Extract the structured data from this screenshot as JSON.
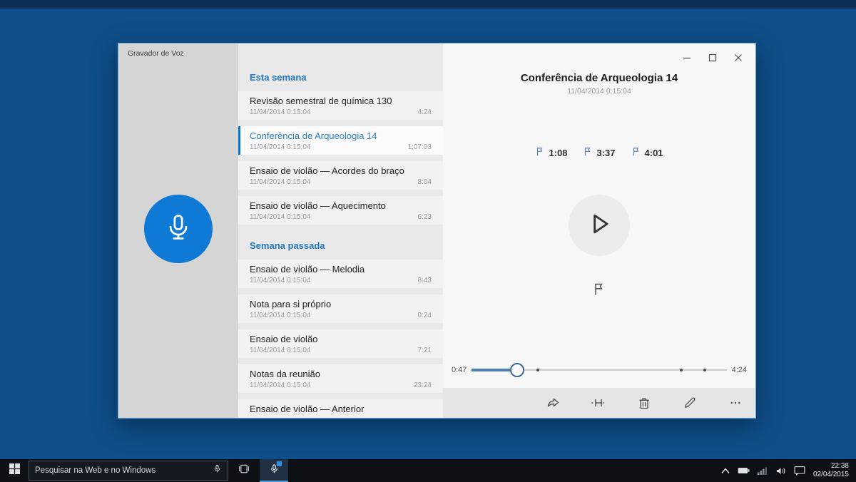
{
  "window": {
    "title": "Gravador de Voz"
  },
  "list": {
    "sections": [
      {
        "header": "Esta semana",
        "items": [
          {
            "title": "Revisão semestral de química 130",
            "date": "11/04/2014 0:15:04",
            "duration": "4:24"
          },
          {
            "title": "Conferência de Arqueologia 14",
            "date": "11/04/2014 0:15:04",
            "duration": "1:07:03",
            "selected": true
          },
          {
            "title": "Ensaio de violão — Acordes do braço",
            "date": "11/04/2014 0:15:04",
            "duration": "8:04"
          },
          {
            "title": "Ensaio de violão — Aquecimento",
            "date": "11/04/2014 0:15:04",
            "duration": "6:23"
          }
        ]
      },
      {
        "header": "Semana passada",
        "items": [
          {
            "title": "Ensaio de violão — Melodia",
            "date": "11/04/2014 0:15:04",
            "duration": "8:43"
          },
          {
            "title": "Nota para si próprio",
            "date": "11/04/2014 0:15:04",
            "duration": "0:24"
          },
          {
            "title": "Ensaio de violão",
            "date": "11/04/2014 0:15:04",
            "duration": "7:21"
          },
          {
            "title": "Notas da reunião",
            "date": "11/04/2014 0:15:04",
            "duration": "23:24"
          },
          {
            "title": "Ensaio de violão — Anterior"
          }
        ]
      }
    ]
  },
  "player": {
    "title": "Conferência de Arqueologia 14",
    "date": "11/04/2014 0:15:04",
    "markers": [
      {
        "time": "1:08"
      },
      {
        "time": "3:37"
      },
      {
        "time": "4:01"
      }
    ],
    "current_time": "0:47",
    "total_time": "4:24"
  },
  "taskbar": {
    "search_placeholder": "Pesquisar na Web e no Windows",
    "clock": {
      "time": "22:38",
      "date": "02/04/2015"
    }
  },
  "colors": {
    "accent": "#0078d7",
    "record_button": "#0f7ad6",
    "desktop": "#0e4e8a",
    "slider_fill": "#4d7fb3"
  }
}
